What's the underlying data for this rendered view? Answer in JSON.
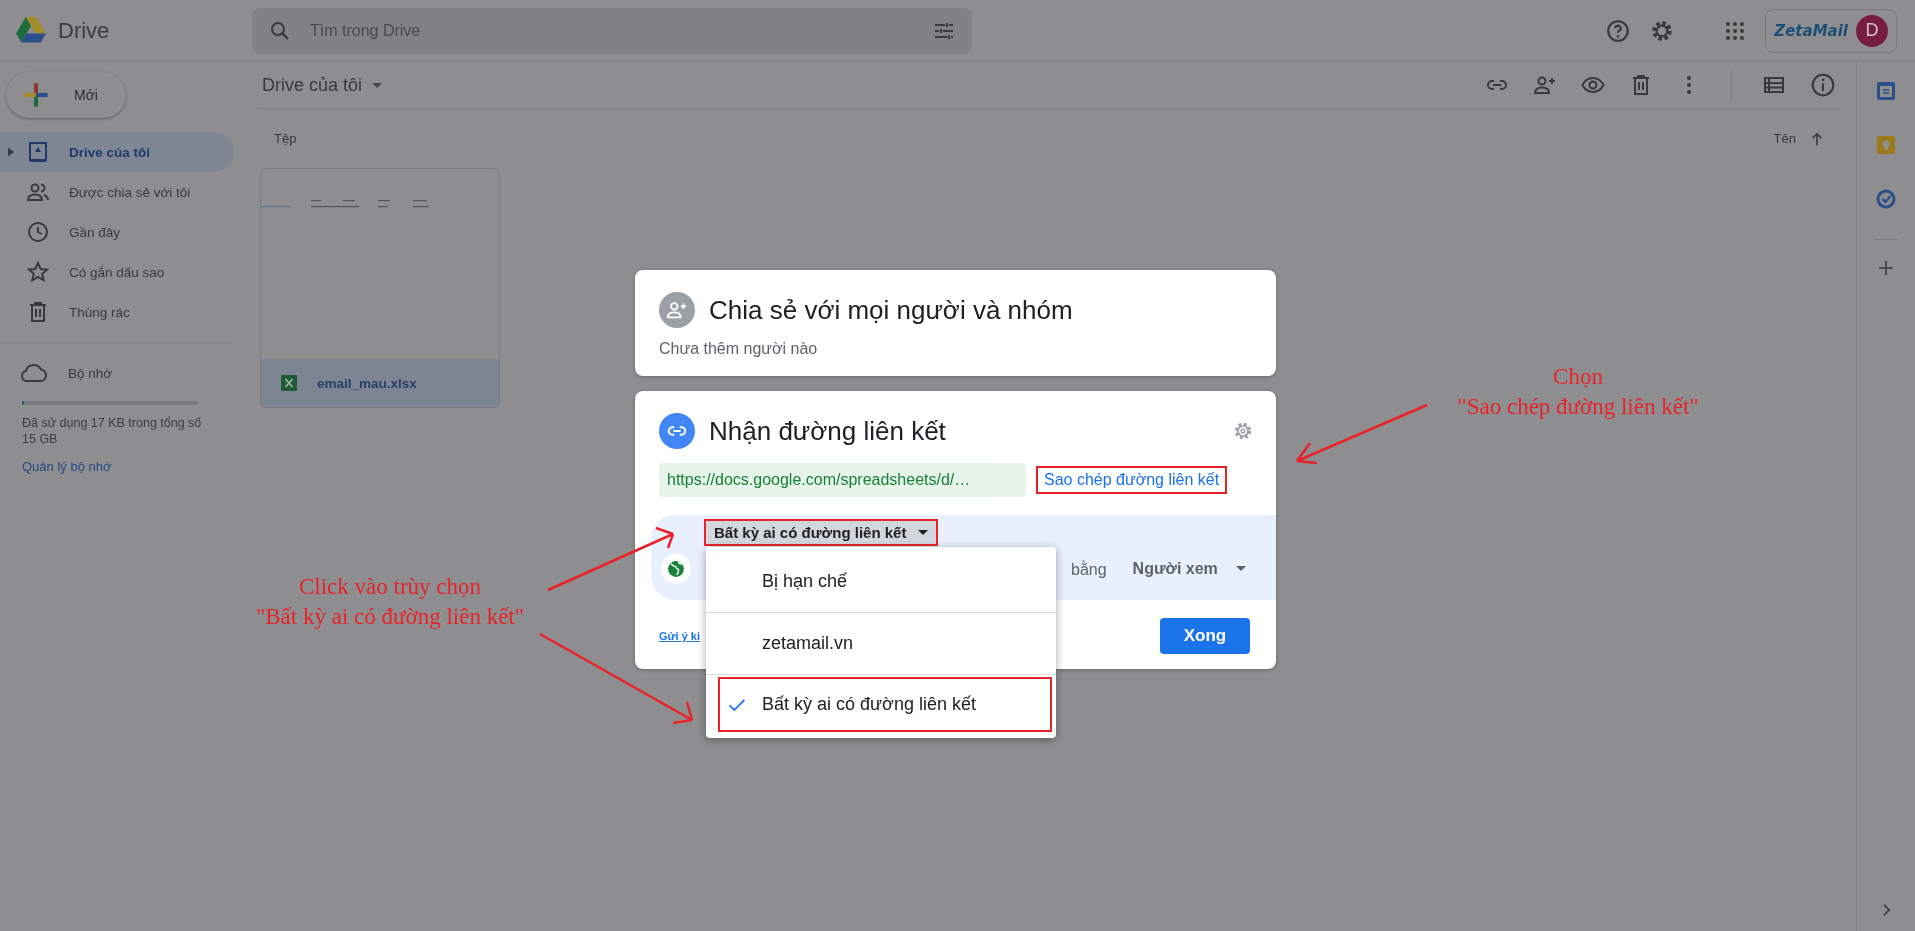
{
  "app": {
    "name": "Drive"
  },
  "search": {
    "placeholder": "Tìm trong Drive"
  },
  "account": {
    "org_logo": "ZetaMail",
    "avatar_initial": "D"
  },
  "new_button": "Mới",
  "sidebar": {
    "items": [
      {
        "label": "Drive của tôi",
        "kind": "drive",
        "selected": true
      },
      {
        "label": "Được chia sẻ với tôi",
        "kind": "shared",
        "selected": false
      },
      {
        "label": "Gần đây",
        "kind": "recent",
        "selected": false
      },
      {
        "label": "Có gắn dấu sao",
        "kind": "starred",
        "selected": false
      },
      {
        "label": "Thùng rác",
        "kind": "trash",
        "selected": false
      }
    ],
    "storage": {
      "label": "Bộ nhớ",
      "level": 0.002,
      "usage": "Đã sử dụng 17 KB trong tổng số 15 GB",
      "manage_link": "Quản lý bộ nhớ"
    }
  },
  "breadcrumb": "Drive của tôi",
  "files": {
    "section": "Tệp",
    "sort": "Tên",
    "items": [
      {
        "name": "email_mau.xlsx",
        "selected": true
      }
    ]
  },
  "dialog": {
    "share": {
      "title": "Chia sẻ với mọi người và nhóm",
      "subtitle": "Chưa thêm người nào"
    },
    "link": {
      "title": "Nhận đường liên kết",
      "url": "https://docs.google.com/spreadsheets/d/…",
      "copy_link": "Sao chép đường liên kết",
      "access_button": "Bất kỳ ai có đường liên kết",
      "access_note": "bằng",
      "role": "Người xem",
      "feedback_link": "Gửi ý ki",
      "done": "Xong"
    }
  },
  "access_menu": {
    "options": [
      {
        "label": "Bị hạn chế",
        "selected": false
      },
      {
        "label": "zetamail.vn",
        "selected": false
      },
      {
        "label": "Bất kỳ ai có đường liên kết",
        "selected": true
      }
    ]
  },
  "annotations": [
    {
      "lines": [
        "Chọn",
        "\"Sao chép đường liên kết\""
      ]
    },
    {
      "lines": [
        "Click vào trùy chọn",
        "\"Bất kỳ ai có đường liên kết\""
      ]
    }
  ]
}
